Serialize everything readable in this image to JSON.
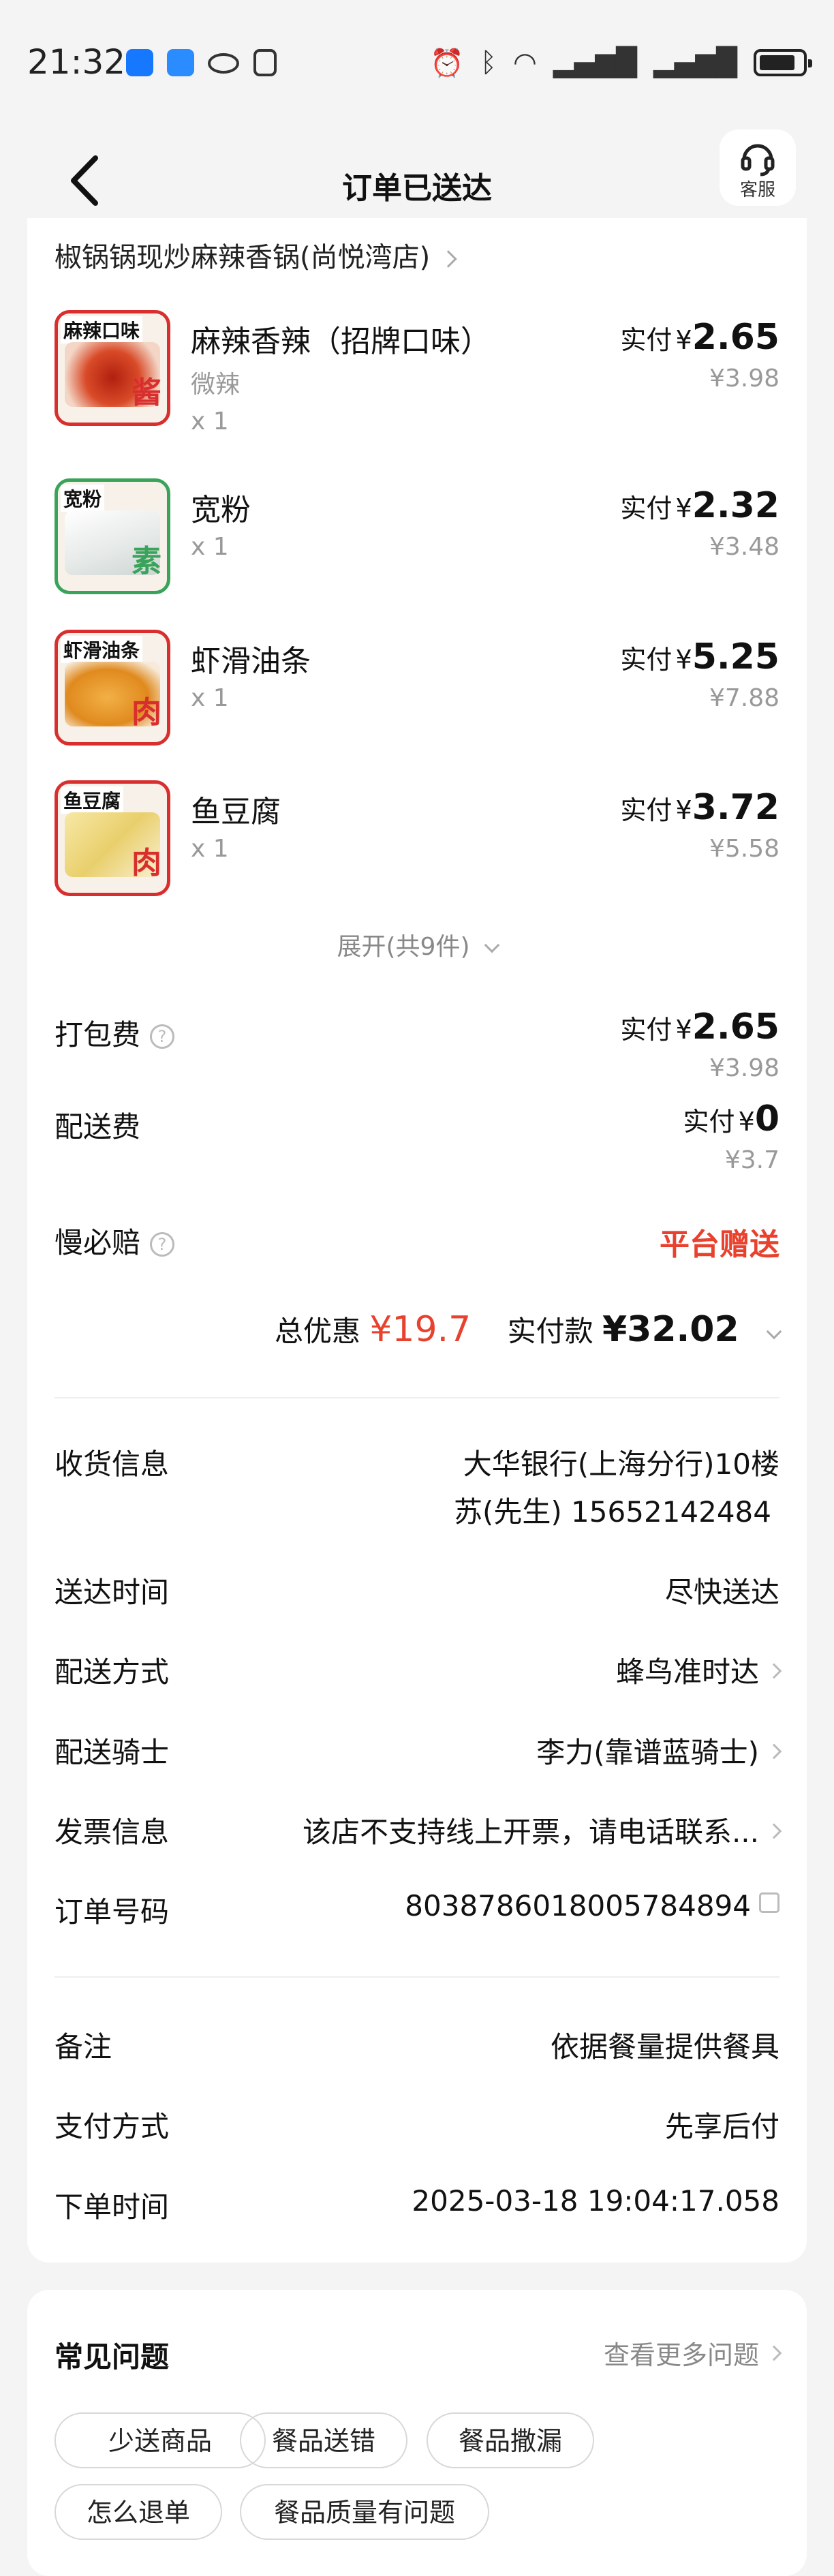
{
  "status": {
    "time": "21:32",
    "icons": [
      "zhihu-app-icon",
      "weather-app-icon",
      "eye-icon",
      "nfc-icon",
      "alarm-icon",
      "bluetooth-icon",
      "wifi-icon",
      "signal-1-icon",
      "signal-2-icon",
      "battery-icon"
    ]
  },
  "header": {
    "title": "订单已送达",
    "service_label": "客服"
  },
  "store": {
    "name": "椒锅锅现炒麻辣香锅(尚悦湾店)"
  },
  "items": [
    {
      "thumb_tag": "麻辣口味",
      "name": "麻辣香辣（招牌口味）",
      "spec": "微辣",
      "qty": "x 1",
      "pay_label": "实付",
      "currency": "¥",
      "price": "2.65",
      "orig": "¥3.98",
      "badge": "酱"
    },
    {
      "thumb_tag": "宽粉",
      "name": "宽粉",
      "spec": "",
      "qty": "x 1",
      "pay_label": "实付",
      "currency": "¥",
      "price": "2.32",
      "orig": "¥3.48",
      "badge": "素"
    },
    {
      "thumb_tag": "虾滑油条",
      "name": "虾滑油条",
      "spec": "",
      "qty": "x 1",
      "pay_label": "实付",
      "currency": "¥",
      "price": "5.25",
      "orig": "¥7.88",
      "badge": "肉"
    },
    {
      "thumb_tag": "鱼豆腐",
      "name": "鱼豆腐",
      "spec": "",
      "qty": "x 1",
      "pay_label": "实付",
      "currency": "¥",
      "price": "3.72",
      "orig": "¥5.58",
      "badge": "肉"
    }
  ],
  "expand_label": "展开(共9件)",
  "fees": {
    "packing": {
      "label": "打包费",
      "pay_label": "实付",
      "currency": "¥",
      "price": "2.65",
      "orig": "¥3.98"
    },
    "delivery": {
      "label": "配送费",
      "pay_label": "实付",
      "currency": "¥",
      "price": "0",
      "orig": "¥3.7"
    },
    "slow_comp": {
      "label": "慢必赔",
      "value": "平台赠送"
    }
  },
  "totals": {
    "discount_label": "总优惠",
    "discount_value": "¥19.7",
    "paid_label": "实付款",
    "paid_value": "¥32.02"
  },
  "info": {
    "address_label": "收货信息",
    "address_line1": "大华银行(上海分行)10楼",
    "address_line2": "苏(先生) 15652142484",
    "time_label": "送达时间",
    "time_value": "尽快送达",
    "method_label": "配送方式",
    "method_value": "蜂鸟准时达",
    "rider_label": "配送骑士",
    "rider_value": "李力(靠谱蓝骑士)",
    "invoice_label": "发票信息",
    "invoice_value": "该店不支持线上开票，请电话联系...",
    "order_label": "订单号码",
    "order_value": "8038786018005784894",
    "note_label": "备注",
    "note_value": "依据餐量提供餐具",
    "pay_label": "支付方式",
    "pay_value": "先享后付",
    "created_label": "下单时间",
    "created_value": "2025-03-18 19:04:17.058"
  },
  "faq": {
    "title": "常见问题",
    "more": "查看更多问题",
    "chips": [
      "少送商品",
      "餐品送错",
      "餐品撒漏",
      "怎么退单",
      "餐品质量有问题"
    ]
  }
}
